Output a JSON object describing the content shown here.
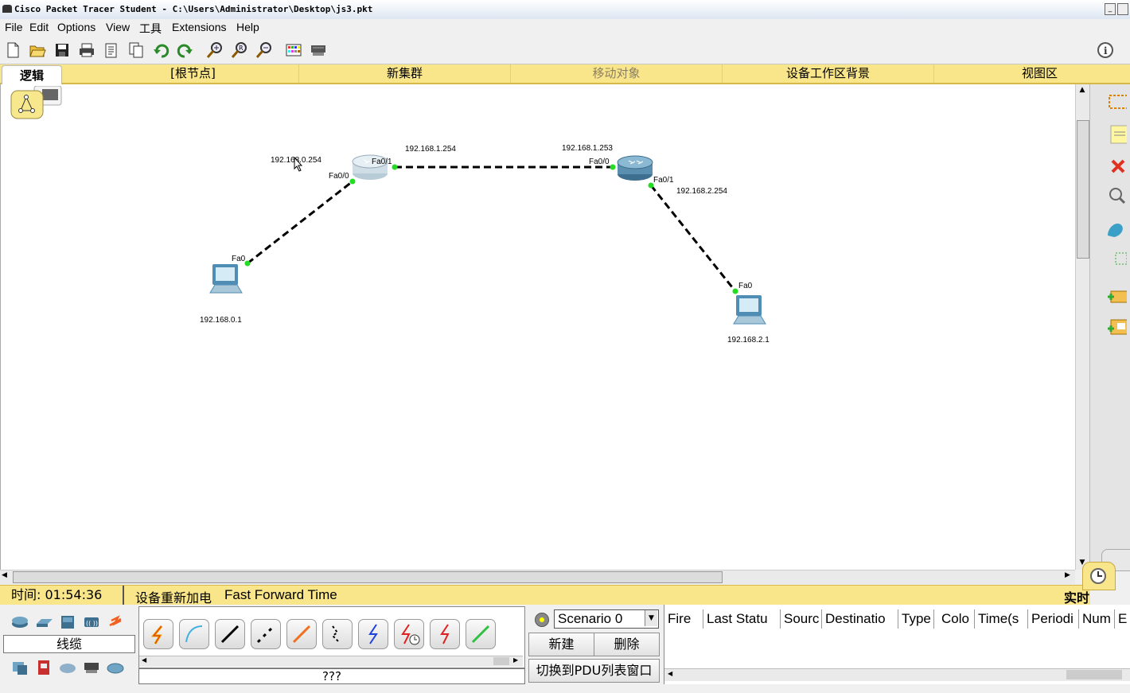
{
  "window": {
    "title": "Cisco Packet Tracer Student - C:\\Users\\Administrator\\Desktop\\js3.pkt"
  },
  "menu": [
    "File",
    "Edit",
    "Options",
    "View",
    "工具",
    "Extensions",
    "Help"
  ],
  "toolbar": {
    "icons": [
      "new-file-icon",
      "open-folder-icon",
      "save-icon",
      "print-icon",
      "activity-wizard-icon",
      "copy-icon",
      "undo-icon",
      "redo-icon",
      "zoom-in-icon",
      "zoom-reset-icon",
      "zoom-out-icon",
      "palette-icon",
      "custom-device-icon",
      "info-icon"
    ]
  },
  "tabs": {
    "logical": "逻辑",
    "root": "[根节点]",
    "new_cluster": "新集群",
    "move_object": "移动对象",
    "workspace_bg": "设备工作区背景",
    "viewport": "视图区"
  },
  "topology": {
    "router1": {
      "port_left": "Fa0/0",
      "port_right": "Fa0/1",
      "ip_left": "192.168.0.254",
      "ip_right": "192.168.1.254"
    },
    "router2": {
      "port_left": "Fa0/0",
      "port_right": "Fa0/1",
      "ip_left": "192.168.1.253",
      "ip_right": "192.168.2.254"
    },
    "pc1": {
      "port": "Fa0",
      "ip": "192.168.0.1"
    },
    "pc2": {
      "port": "Fa0",
      "ip": "192.168.2.1"
    }
  },
  "status": {
    "time_label": "时间: 01:54:36",
    "power_cycle": "设备重新加电",
    "fast_forward": "Fast Forward Time",
    "realtime": "实时"
  },
  "devices": {
    "category_label": "线缆",
    "selected_label": "???"
  },
  "cable_types": [
    "auto-connect",
    "console",
    "copper-straight",
    "copper-cross",
    "fiber",
    "phone",
    "coaxial",
    "serial-dce",
    "serial-dte",
    "octal"
  ],
  "pdu": {
    "scenario": "Scenario 0",
    "new_label": "新建",
    "delete_label": "删除",
    "switch_label": "切换到PDU列表窗口",
    "columns": [
      "Fire",
      "Last Statu",
      "Sourc",
      "Destinatio",
      "Type",
      "Colo",
      "Time(s",
      "Periodi",
      "Num",
      "E"
    ]
  }
}
